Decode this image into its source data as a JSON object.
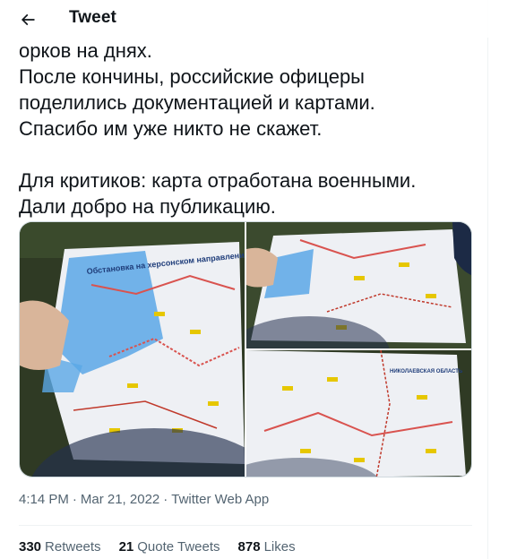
{
  "header": {
    "title": "Tweet"
  },
  "tweet": {
    "lines": [
      "орков на днях.",
      "После кончины, российские офицеры",
      "поделились документацией и картами.",
      "Спасибо им уже никто не скажет.",
      "",
      "Для критиков: карта отработана военными.",
      "Дали добро на публикацию."
    ],
    "map_title": "Обстановка на херсонском направлении",
    "region_label": "НИКОЛАЕВСКАЯ ОБЛАСТЬ",
    "time": "4:14 PM",
    "date": "Mar 21, 2022",
    "separator": "·",
    "source": "Twitter Web App"
  },
  "stats": [
    {
      "count": "330",
      "label": "Retweets"
    },
    {
      "count": "21",
      "label": "Quote Tweets"
    },
    {
      "count": "878",
      "label": "Likes"
    }
  ],
  "colors": {
    "text": "#0f1419",
    "secondary": "#536471",
    "border": "#eff3f4",
    "map_water": "#5aa7e6",
    "map_paper": "#eef0f4",
    "grass": "#2f3a24"
  }
}
